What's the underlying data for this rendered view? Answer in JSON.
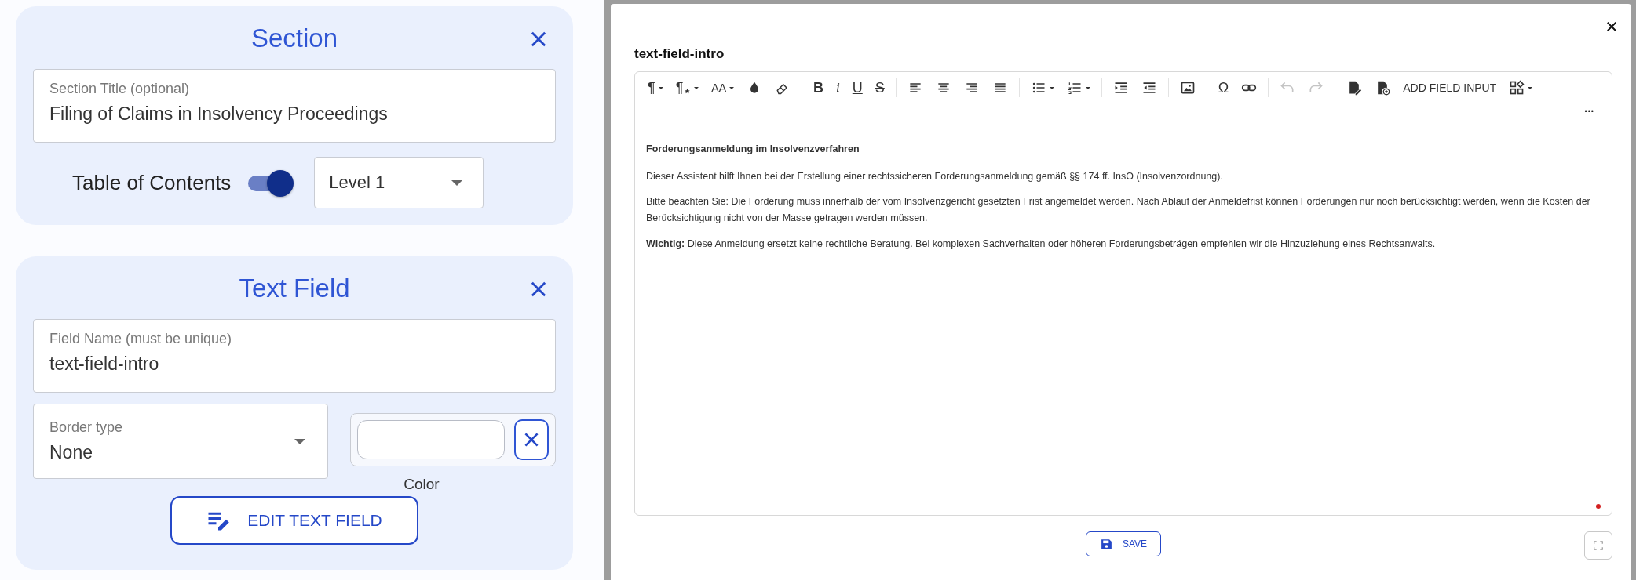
{
  "section_card": {
    "title": "Section",
    "title_field": {
      "label": "Section Title (optional)",
      "value": "Filing of Claims in Insolvency Proceedings"
    },
    "toc": {
      "label": "Table of Contents",
      "on": true
    },
    "level_select": {
      "value": "Level 1"
    }
  },
  "text_field_card": {
    "title": "Text Field",
    "name_field": {
      "label": "Field Name (must be unique)",
      "value": "text-field-intro"
    },
    "border_select": {
      "label": "Border type",
      "value": "None"
    },
    "color_label": "Color",
    "edit_button": "EDIT TEXT FIELD"
  },
  "editor_dialog": {
    "title": "text-field-intro",
    "toolbar": [
      [
        {
          "kind": "paragraph",
          "text": "¶",
          "dropdown": true,
          "disabled": false
        },
        {
          "kind": "paragraph-format",
          "text": "¶",
          "dropdown": true,
          "disabled": false
        },
        {
          "kind": "font-size",
          "text": "AA",
          "dropdown": true,
          "disabled": false
        },
        {
          "kind": "text-color",
          "dropdown": false,
          "disabled": false
        },
        {
          "kind": "highlight",
          "dropdown": false,
          "disabled": false
        }
      ],
      [
        {
          "kind": "bold",
          "text": "B",
          "dropdown": false,
          "disabled": false
        },
        {
          "kind": "italic",
          "text": "i",
          "dropdown": false,
          "disabled": false
        },
        {
          "kind": "underline",
          "text": "U",
          "dropdown": false,
          "disabled": false
        },
        {
          "kind": "strike",
          "text": "S",
          "dropdown": false,
          "disabled": false
        }
      ],
      [
        {
          "kind": "align-left",
          "dropdown": false,
          "disabled": false
        },
        {
          "kind": "align-center",
          "dropdown": false,
          "disabled": false
        },
        {
          "kind": "align-right",
          "dropdown": false,
          "disabled": false
        },
        {
          "kind": "justify",
          "dropdown": false,
          "disabled": false
        }
      ],
      [
        {
          "kind": "bullet-list",
          "dropdown": true,
          "disabled": false
        },
        {
          "kind": "numbered-list",
          "dropdown": true,
          "disabled": false
        }
      ],
      [
        {
          "kind": "indent",
          "dropdown": false,
          "disabled": false
        },
        {
          "kind": "outdent",
          "dropdown": false,
          "disabled": false
        }
      ],
      [
        {
          "kind": "image",
          "dropdown": false,
          "disabled": false
        }
      ],
      [
        {
          "kind": "special-char",
          "text": "Ω",
          "dropdown": false,
          "disabled": false
        },
        {
          "kind": "link",
          "dropdown": false,
          "disabled": false
        }
      ],
      [
        {
          "kind": "undo",
          "dropdown": false,
          "disabled": true
        },
        {
          "kind": "redo",
          "dropdown": false,
          "disabled": true
        }
      ],
      [
        {
          "kind": "doc-edit",
          "dropdown": false,
          "disabled": false
        },
        {
          "kind": "doc-add",
          "dropdown": false,
          "disabled": false
        },
        {
          "kind": "text-button",
          "text": "ADD FIELD INPUT",
          "dropdown": false,
          "disabled": false
        },
        {
          "kind": "shapes",
          "dropdown": true,
          "disabled": false
        }
      ]
    ],
    "more": "•••",
    "content": [
      {
        "kind": "heading",
        "text": "Forderungsanmeldung im Insolvenzverfahren"
      },
      {
        "kind": "paragraph",
        "text": "Dieser Assistent hilft Ihnen bei der Erstellung einer rechtssicheren Forderungsanmeldung gemäß §§ 174 ff. InsO (Insolvenzordnung)."
      },
      {
        "kind": "paragraph",
        "text": "Bitte beachten Sie: Die Forderung muss innerhalb der vom Insolvenzgericht gesetzten Frist angemeldet werden. Nach Ablauf der Anmeldefrist können Forderungen nur noch berücksichtigt werden, wenn die Kosten der Berücksichtigung nicht von der Masse getragen werden müssen."
      },
      {
        "kind": "paragraph",
        "text": "**Wichtig:** Diese Anmeldung ersetzt keine rechtliche Beratung. Bei komplexen Sachverhalten oder höheren Forderungsbeträgen empfehlen wir die Hinzuziehung eines Rechtsanwalts."
      }
    ],
    "save_button": "SAVE"
  }
}
